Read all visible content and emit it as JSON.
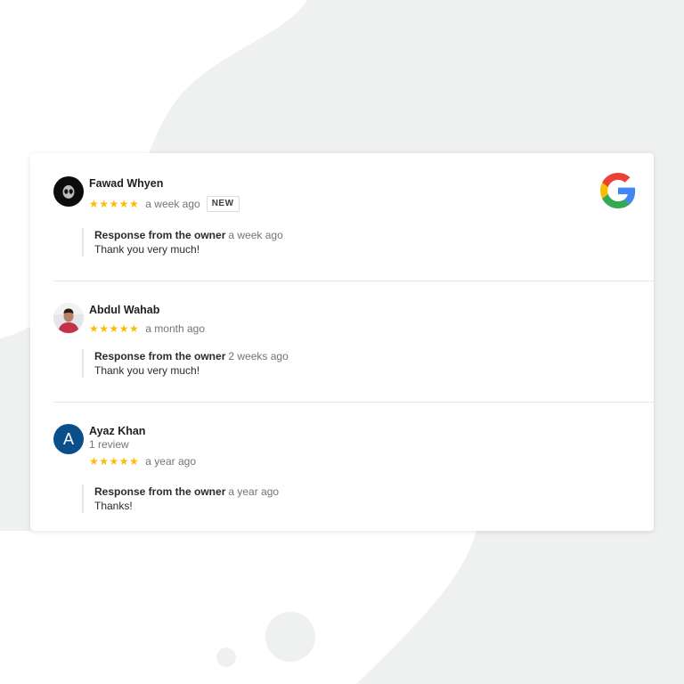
{
  "reviews": [
    {
      "name": "Fawad Whyen",
      "sub_text": "",
      "stars": "★★★★★",
      "when": "a week ago",
      "badge": "NEW",
      "response_title": "Response from the owner",
      "response_when": "a week ago",
      "response_text": "Thank you very much!",
      "avatar": "alien-avatar-icon"
    },
    {
      "name": "Abdul Wahab",
      "sub_text": "",
      "stars": "★★★★★",
      "when": "a month ago",
      "badge": "",
      "response_title": "Response from the owner",
      "response_when": "2 weeks ago",
      "response_text": "Thank you very much!",
      "avatar": "photo-avatar"
    },
    {
      "name": "Ayaz Khan",
      "sub_text": "1 review",
      "stars": "★★★★★",
      "when": "a year ago",
      "badge": "",
      "response_title": "Response from the owner",
      "response_when": "a year ago",
      "response_text": "Thanks!",
      "avatar": "letter-avatar",
      "avatar_letter": "A"
    }
  ],
  "rating": {
    "value": 5,
    "max": 5
  },
  "colors": {
    "star": "#fbbc04",
    "avatar_letter_bg": "#0b4f8a",
    "background": "#eff1f0",
    "card": "#ffffff",
    "google_blue": "#4285f4",
    "google_red": "#ea4335",
    "google_yellow": "#fbbc05",
    "google_green": "#34a853"
  },
  "brand_icon": "google-g-icon"
}
